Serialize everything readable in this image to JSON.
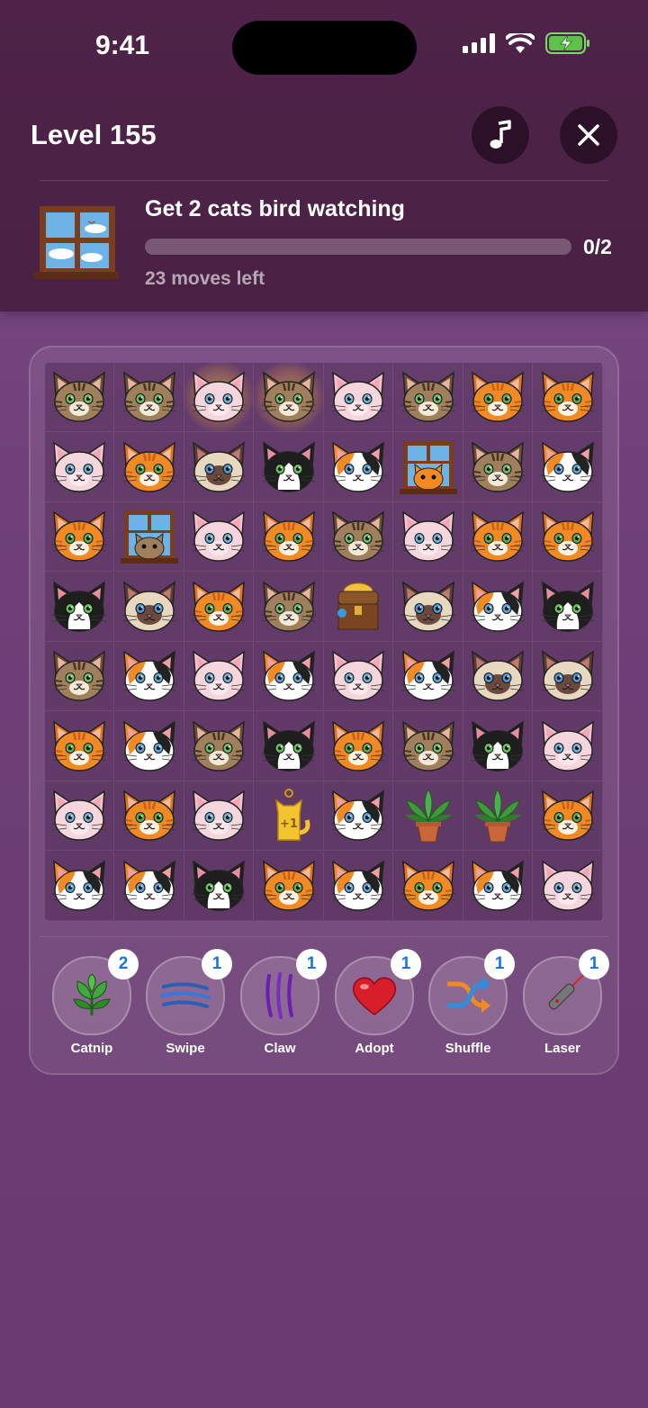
{
  "status": {
    "time": "9:41"
  },
  "header": {
    "level_title": "Level 155",
    "music_icon": "music-note-icon",
    "close_icon": "close-icon"
  },
  "goal": {
    "text": "Get 2 cats bird watching",
    "progress_current": 0,
    "progress_target": 2,
    "progress_label": "0/2",
    "moves_left": "23 moves left"
  },
  "board": {
    "rows": [
      [
        "tabby",
        "tabby",
        "sphynx",
        "tabby",
        "sphynx",
        "tabby",
        "orange",
        "orange"
      ],
      [
        "sphynx",
        "orange",
        "siamese",
        "tuxedo",
        "calico",
        "window-orange",
        "tabby",
        "calico"
      ],
      [
        "orange",
        "window-tabby",
        "sphynx",
        "orange",
        "tabby",
        "sphynx",
        "orange",
        "orange"
      ],
      [
        "tuxedo",
        "siamese",
        "orange",
        "tabby",
        "treasure-chest",
        "siamese",
        "calico",
        "tuxedo"
      ],
      [
        "tabby",
        "calico",
        "sphynx",
        "calico",
        "sphynx",
        "calico",
        "siamese",
        "siamese"
      ],
      [
        "orange",
        "calico",
        "tabby",
        "tuxedo",
        "orange",
        "tabby",
        "tuxedo",
        "sphynx"
      ],
      [
        "sphynx",
        "orange",
        "sphynx",
        "gold-cat-plus-one",
        "calico",
        "potted-plant",
        "potted-plant",
        "orange"
      ],
      [
        "calico",
        "calico",
        "tuxedo",
        "orange",
        "calico",
        "orange",
        "calico",
        "sphynx"
      ]
    ],
    "highlighted": [
      "0-2",
      "0-3"
    ],
    "colors": {
      "tabby": "#8a6a4a",
      "orange": "#f08a2a",
      "sphynx": "#f6d3da",
      "siamese": "#5a3f35",
      "tuxedo": "#1e1e1e",
      "calico": "#f08a2a"
    }
  },
  "boosters": [
    {
      "label": "Catnip",
      "count": "2",
      "icon": "catnip-leaf-icon"
    },
    {
      "label": "Swipe",
      "count": "1",
      "icon": "swipe-slash-icon"
    },
    {
      "label": "Claw",
      "count": "1",
      "icon": "claw-marks-icon"
    },
    {
      "label": "Adopt",
      "count": "1",
      "icon": "heart-icon"
    },
    {
      "label": "Shuffle",
      "count": "1",
      "icon": "shuffle-icon"
    },
    {
      "label": "Laser",
      "count": "1",
      "icon": "laser-pointer-icon"
    }
  ]
}
